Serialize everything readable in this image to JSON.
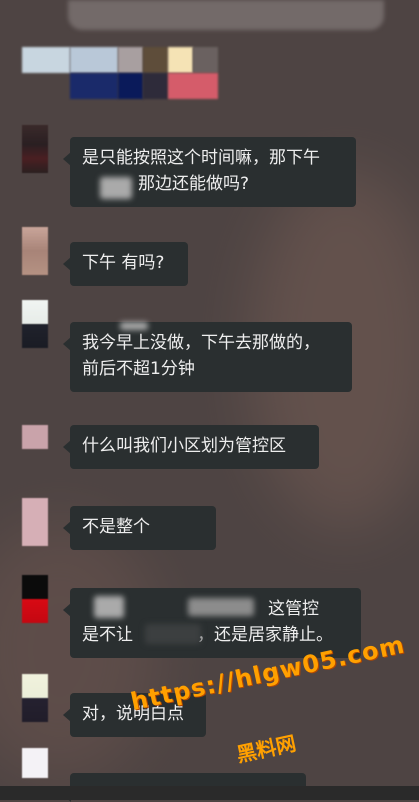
{
  "colors": {
    "background": "#4e4443",
    "bubble": "#2a2f30",
    "bubble_text": "#eeeeee",
    "watermark": "#ffa000"
  },
  "messages": [
    {
      "lines": [
        "是只能按照这个时间嘛，那下午",
        "那边还能做吗?"
      ]
    },
    {
      "lines": [
        "下午 有吗?"
      ]
    },
    {
      "lines": [
        "我今早上没做，下午去那做的，",
        "前后不超1分钟"
      ]
    },
    {
      "lines": [
        "什么叫我们小区划为管控区"
      ]
    },
    {
      "lines": [
        "不是整个"
      ]
    },
    {
      "lines": [
        "这管控",
        "是不让",
        "，还是居家静止。"
      ]
    },
    {
      "lines": [
        "对，说明白点"
      ]
    }
  ],
  "watermark": {
    "url": "https://hlgw05.com",
    "label": "黑料网"
  }
}
